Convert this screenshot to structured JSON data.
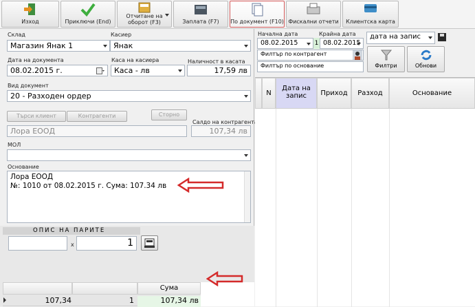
{
  "toolbar": {
    "exit": "Изход",
    "close": "Приключи (End)",
    "report": "Отчитане на оборот (F3)",
    "salary": "Заплата (F7)",
    "by_doc": "По документ (F10)",
    "fiscal": "Фискални отчети",
    "client_card": "Клиентска карта"
  },
  "form": {
    "warehouse_label": "Склад",
    "warehouse": "Магазин Янак 1",
    "cashier_label": "Касиер",
    "cashier": "Янак",
    "doc_date_label": "Дата на документа",
    "doc_date": "08.02.2015 г.",
    "cashier_cash_label": "Каса на касиера",
    "cashier_cash": "Каса - лв",
    "cash_avail_label": "Наличност в касата",
    "cash_avail": "17,59 лв",
    "doc_type_label": "Вид документ",
    "doc_type": "20 - Разходен ордер",
    "find_client": "Търси клиент",
    "contragents": "Контрагенти",
    "storno": "Сторно",
    "balance_label": "Салдо на контрагента",
    "contragent": "Лора ЕООД",
    "balance": "107,34 лв",
    "mol_label": "МОЛ",
    "basis_label": "Основание",
    "basis_line1": "Лора ЕООД",
    "basis_line2": "№: 1010 от 08.02.2015 г.  Сума: 107.34 лв"
  },
  "money": {
    "title": "ОПИС НА ПАРИТЕ",
    "times": "x",
    "qty": "1",
    "col_sum": "Сума",
    "row_value": "107,34",
    "row_qty": "1",
    "row_sum": "107,34 лв"
  },
  "right": {
    "start_date_label": "Начална дата",
    "start_date": "08.02.2015",
    "day_count": "1",
    "end_date_label": "Крайна дата",
    "end_date": "08.02.2015",
    "sort": "дата на запис",
    "filter_contragent": "Филтър по контрагент",
    "filter_basis": "Филтър по основание",
    "filters_btn": "Филтри",
    "refresh_btn": "Обнови",
    "columns": [
      "N",
      "Дата на запис",
      "Приход",
      "Разход",
      "Основание"
    ]
  },
  "colors": {
    "arrow": "#d42a2a",
    "highlight_col": "#d8d8f4",
    "green_cell": "#e6f6e6"
  }
}
